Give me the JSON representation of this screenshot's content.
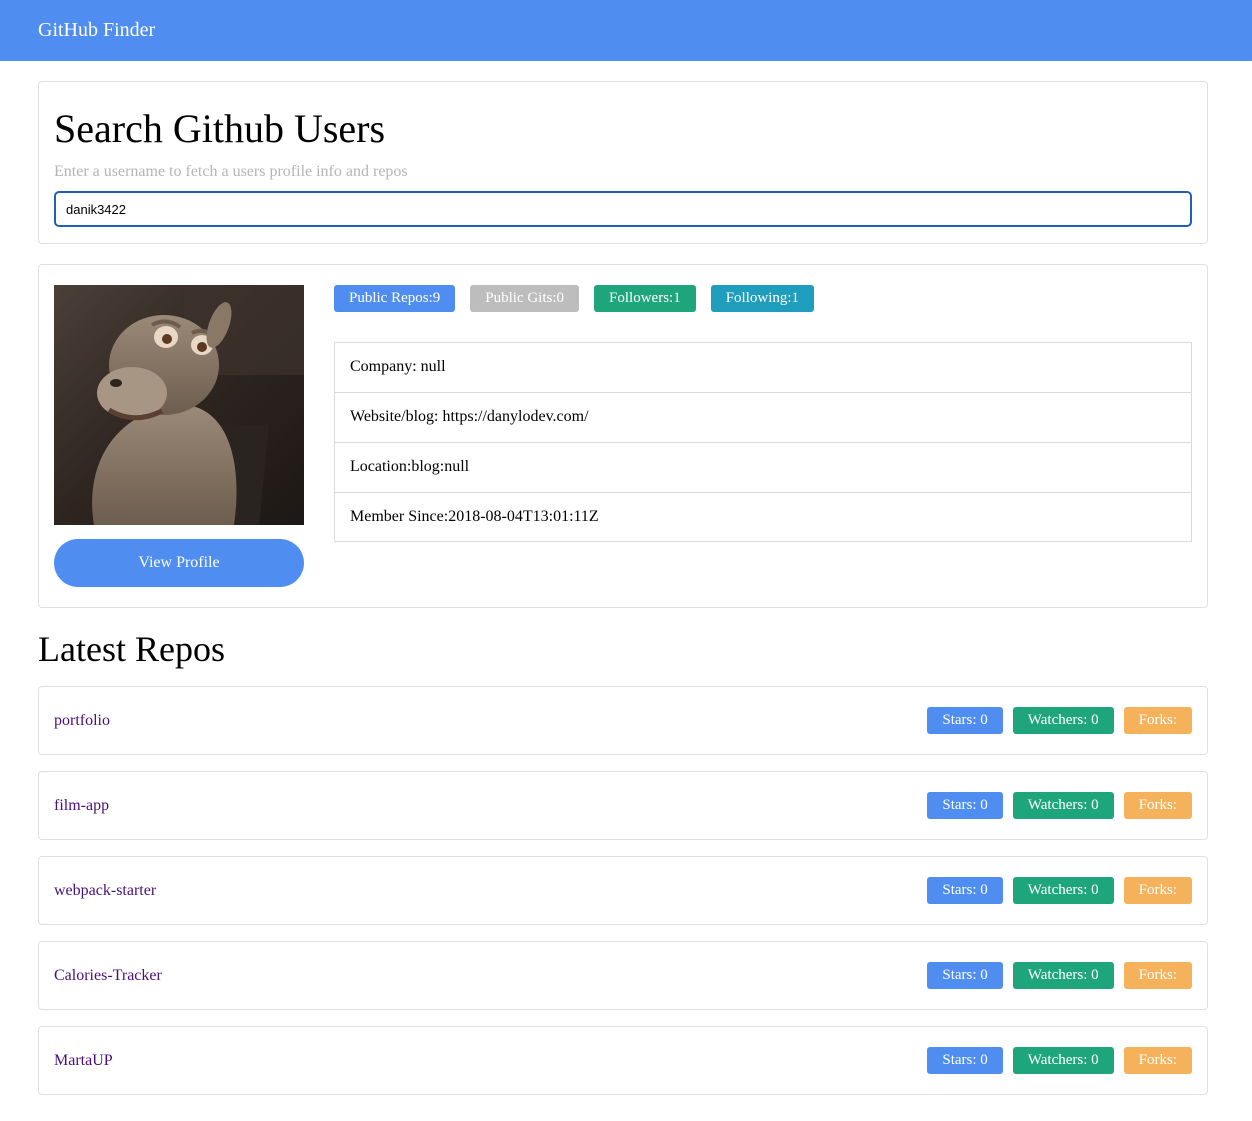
{
  "navbar": {
    "brand": "GitHub Finder"
  },
  "search": {
    "title": "Search Github Users",
    "subtitle": "Enter a username to fetch a users profile info and repos",
    "value": "danik3422"
  },
  "profile": {
    "view_button": "View Profile",
    "badges": {
      "public_repos": "Public Repos:9",
      "public_gists": "Public Gits:0",
      "followers": "Followers:1",
      "following": "Following:1"
    },
    "info": {
      "company": "Company: null",
      "website": "Website/blog: https://danylodev.com/",
      "location": "Location:blog:null",
      "member_since": "Member Since:2018-08-04T13:01:11Z"
    }
  },
  "repos": {
    "title": "Latest Repos",
    "items": [
      {
        "name": "portfolio",
        "stars": "Stars: 0",
        "watchers": "Watchers: 0",
        "forks": "Forks:"
      },
      {
        "name": "film-app",
        "stars": "Stars: 0",
        "watchers": "Watchers: 0",
        "forks": "Forks:"
      },
      {
        "name": "webpack-starter",
        "stars": "Stars: 0",
        "watchers": "Watchers: 0",
        "forks": "Forks:"
      },
      {
        "name": "Calories-Tracker",
        "stars": "Stars: 0",
        "watchers": "Watchers: 0",
        "forks": "Forks:"
      },
      {
        "name": "MartaUP",
        "stars": "Stars: 0",
        "watchers": "Watchers: 0",
        "forks": "Forks:"
      }
    ]
  },
  "colors": {
    "primary": "#4f8ef0",
    "gray": "#bdbdbd",
    "success": "#1fa57c",
    "info": "#1f9dbd",
    "warning": "#f5b25a",
    "repo_link": "#4a0f7a"
  }
}
